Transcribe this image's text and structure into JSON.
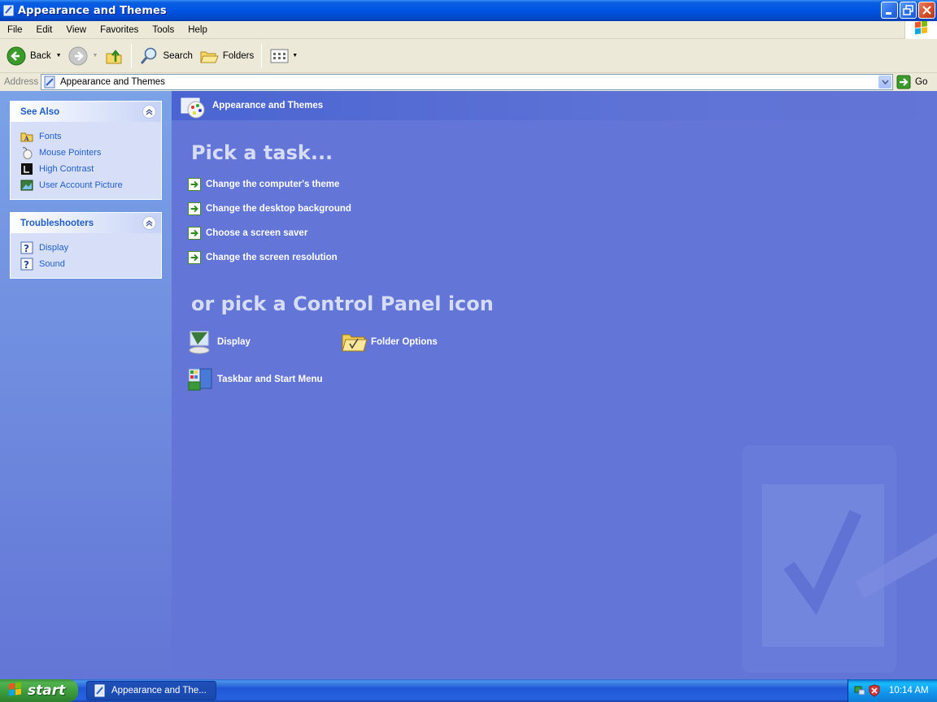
{
  "window": {
    "title": "Appearance and Themes"
  },
  "menu": [
    "File",
    "Edit",
    "View",
    "Favorites",
    "Tools",
    "Help"
  ],
  "toolbar": {
    "back": "Back",
    "search": "Search",
    "folders": "Folders"
  },
  "address": {
    "label": "Address",
    "value": "Appearance and Themes",
    "go": "Go"
  },
  "see_also": {
    "title": "See Also",
    "items": [
      "Fonts",
      "Mouse Pointers",
      "High Contrast",
      "User Account Picture"
    ]
  },
  "troubleshooters": {
    "title": "Troubleshooters",
    "items": [
      "Display",
      "Sound"
    ]
  },
  "content": {
    "header": "Appearance and Themes",
    "pick_task": "Pick a task...",
    "tasks": [
      "Change the computer's theme",
      "Change the desktop background",
      "Choose a screen saver",
      "Change the screen resolution"
    ],
    "pick_icon": "or pick a Control Panel icon",
    "icons": [
      "Display",
      "Folder Options",
      "Taskbar and Start Menu"
    ]
  },
  "taskbar": {
    "start": "start",
    "item": "Appearance and The...",
    "clock": "10:14 AM"
  },
  "colors": {
    "content_bg": "#6375d6",
    "link": "#215dc6",
    "taskbar": "#2157d7",
    "start_green": "#3a9a3a"
  }
}
